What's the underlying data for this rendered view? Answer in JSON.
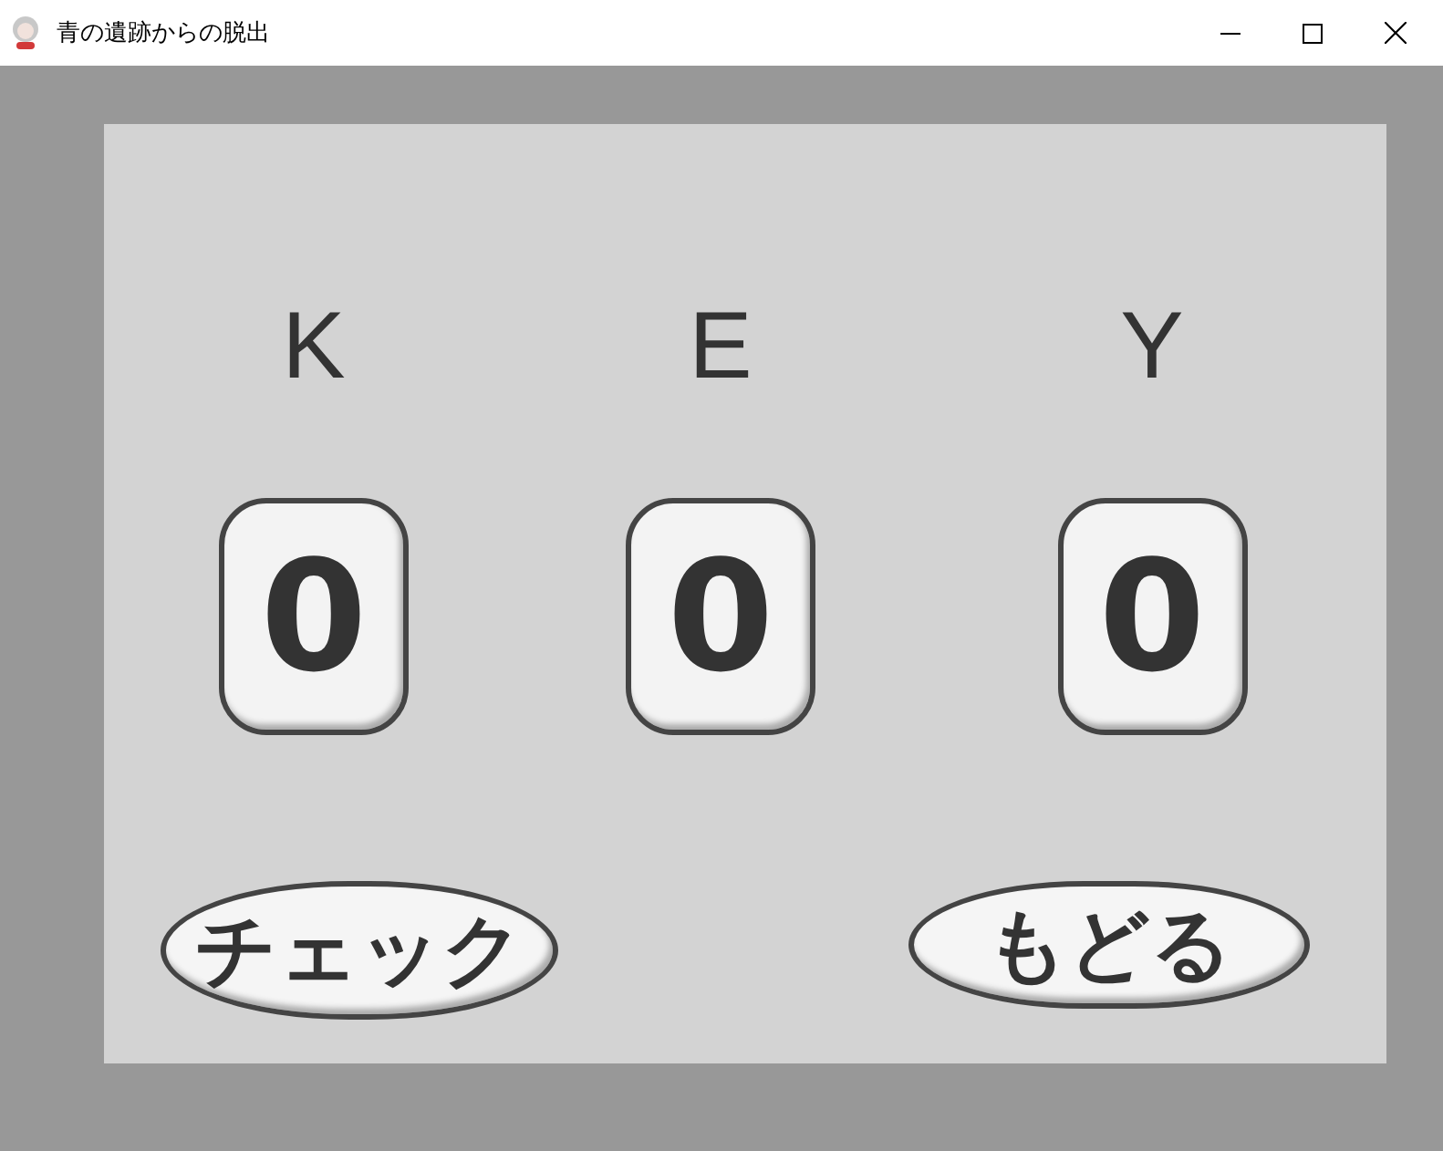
{
  "window": {
    "title": "青の遺跡からの脱出"
  },
  "columns": [
    {
      "label": "K",
      "digit": "0"
    },
    {
      "label": "E",
      "digit": "0"
    },
    {
      "label": "Y",
      "digit": "0"
    }
  ],
  "buttons": [
    {
      "label": "チェック"
    },
    {
      "label": "もどる"
    }
  ]
}
